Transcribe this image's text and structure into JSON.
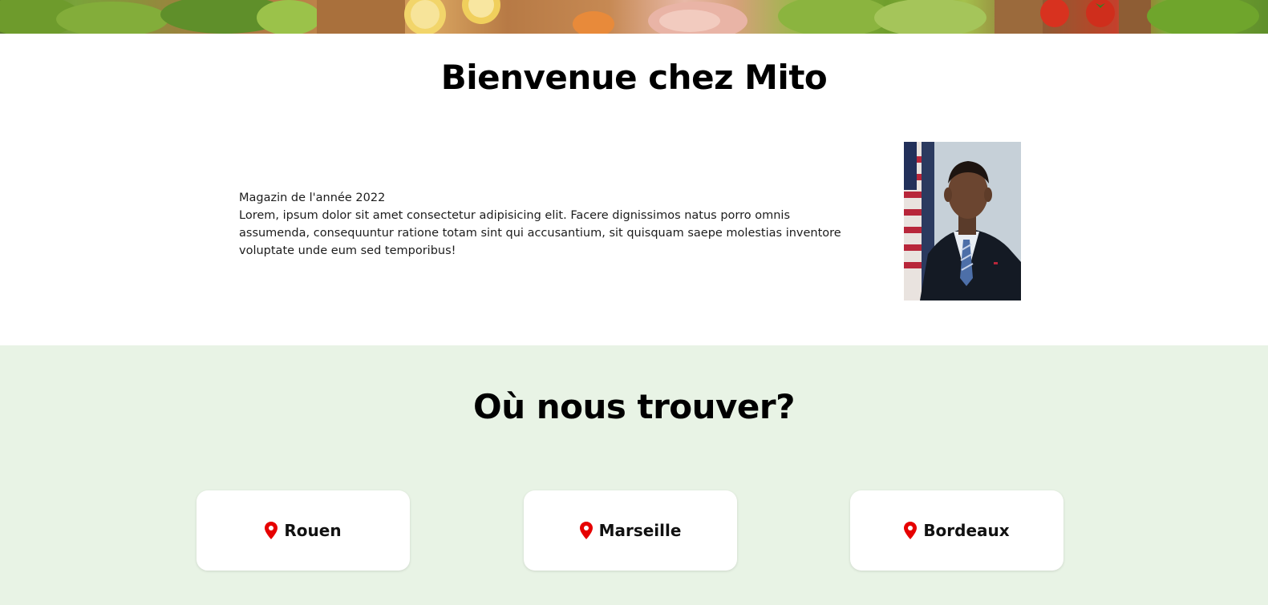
{
  "welcome": {
    "title": "Bienvenue chez Mito",
    "intro_heading": "Magazin de l'année 2022",
    "intro_text": "Lorem, ipsum dolor sit amet consectetur adipisicing elit. Facere dignissimos natus porro omnis assumenda, consequuntur ratione totam sint qui accusantium, sit quisquam saepe molestias inventore voluptate unde eum sed temporibus!"
  },
  "locations": {
    "title": "Où nous trouver?",
    "cities": [
      {
        "name": "Rouen",
        "icon": "map-pin-icon"
      },
      {
        "name": "Marseille",
        "icon": "map-pin-icon"
      },
      {
        "name": "Bordeaux",
        "icon": "map-pin-icon"
      }
    ]
  },
  "colors": {
    "locations_background": "#e8f3e5",
    "pin_red": "#e60000",
    "card_background": "#ffffff"
  }
}
